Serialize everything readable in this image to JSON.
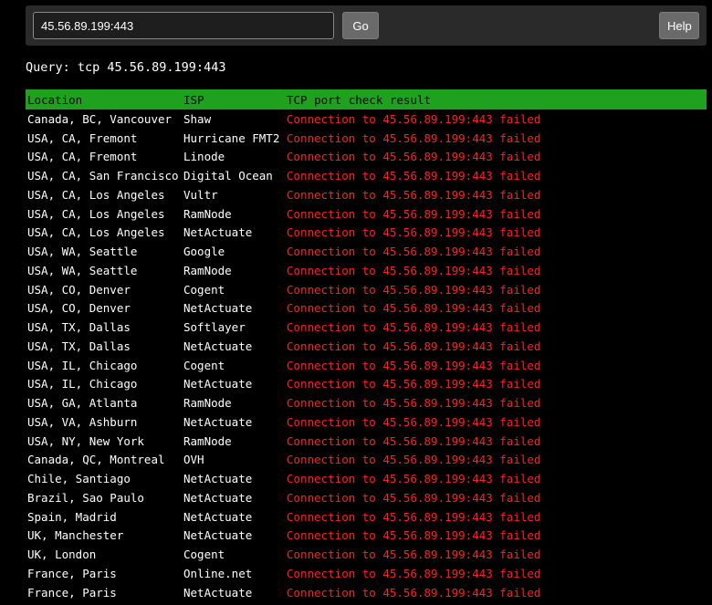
{
  "toolbar": {
    "input_value": "45.56.89.199:443",
    "go_label": "Go",
    "help_label": "Help"
  },
  "query_line": "Query: tcp 45.56.89.199:443",
  "table": {
    "headers": [
      "Location",
      "ISP",
      "TCP port check result"
    ],
    "header_color": "#1fa11f",
    "result_color": "#ff2020",
    "rows": [
      {
        "location": "Canada, BC, Vancouver",
        "isp": "Shaw",
        "result": "Connection to 45.56.89.199:443 failed"
      },
      {
        "location": "USA, CA, Fremont",
        "isp": "Hurricane FMT2",
        "result": "Connection to 45.56.89.199:443 failed"
      },
      {
        "location": "USA, CA, Fremont",
        "isp": "Linode",
        "result": "Connection to 45.56.89.199:443 failed"
      },
      {
        "location": "USA, CA, San Francisco",
        "isp": "Digital Ocean",
        "result": "Connection to 45.56.89.199:443 failed"
      },
      {
        "location": "USA, CA, Los Angeles",
        "isp": "Vultr",
        "result": "Connection to 45.56.89.199:443 failed"
      },
      {
        "location": "USA, CA, Los Angeles",
        "isp": "RamNode",
        "result": "Connection to 45.56.89.199:443 failed"
      },
      {
        "location": "USA, CA, Los Angeles",
        "isp": "NetActuate",
        "result": "Connection to 45.56.89.199:443 failed"
      },
      {
        "location": "USA, WA, Seattle",
        "isp": "Google",
        "result": "Connection to 45.56.89.199:443 failed"
      },
      {
        "location": "USA, WA, Seattle",
        "isp": "RamNode",
        "result": "Connection to 45.56.89.199:443 failed"
      },
      {
        "location": "USA, CO, Denver",
        "isp": "Cogent",
        "result": "Connection to 45.56.89.199:443 failed"
      },
      {
        "location": "USA, CO, Denver",
        "isp": "NetActuate",
        "result": "Connection to 45.56.89.199:443 failed"
      },
      {
        "location": "USA, TX, Dallas",
        "isp": "Softlayer",
        "result": "Connection to 45.56.89.199:443 failed"
      },
      {
        "location": "USA, TX, Dallas",
        "isp": "NetActuate",
        "result": "Connection to 45.56.89.199:443 failed"
      },
      {
        "location": "USA, IL, Chicago",
        "isp": "Cogent",
        "result": "Connection to 45.56.89.199:443 failed"
      },
      {
        "location": "USA, IL, Chicago",
        "isp": "NetActuate",
        "result": "Connection to 45.56.89.199:443 failed"
      },
      {
        "location": "USA, GA, Atlanta",
        "isp": "RamNode",
        "result": "Connection to 45.56.89.199:443 failed"
      },
      {
        "location": "USA, VA, Ashburn",
        "isp": "NetActuate",
        "result": "Connection to 45.56.89.199:443 failed"
      },
      {
        "location": "USA, NY, New York",
        "isp": "RamNode",
        "result": "Connection to 45.56.89.199:443 failed"
      },
      {
        "location": "Canada, QC, Montreal",
        "isp": "OVH",
        "result": "Connection to 45.56.89.199:443 failed"
      },
      {
        "location": "Chile, Santiago",
        "isp": "NetActuate",
        "result": "Connection to 45.56.89.199:443 failed"
      },
      {
        "location": "Brazil, Sao Paulo",
        "isp": "NetActuate",
        "result": "Connection to 45.56.89.199:443 failed"
      },
      {
        "location": "Spain, Madrid",
        "isp": "NetActuate",
        "result": "Connection to 45.56.89.199:443 failed"
      },
      {
        "location": "UK, Manchester",
        "isp": "NetActuate",
        "result": "Connection to 45.56.89.199:443 failed"
      },
      {
        "location": "UK, London",
        "isp": "Cogent",
        "result": "Connection to 45.56.89.199:443 failed"
      },
      {
        "location": "France, Paris",
        "isp": "Online.net",
        "result": "Connection to 45.56.89.199:443 failed"
      },
      {
        "location": "France, Paris",
        "isp": "NetActuate",
        "result": "Connection to 45.56.89.199:443 failed"
      }
    ]
  }
}
